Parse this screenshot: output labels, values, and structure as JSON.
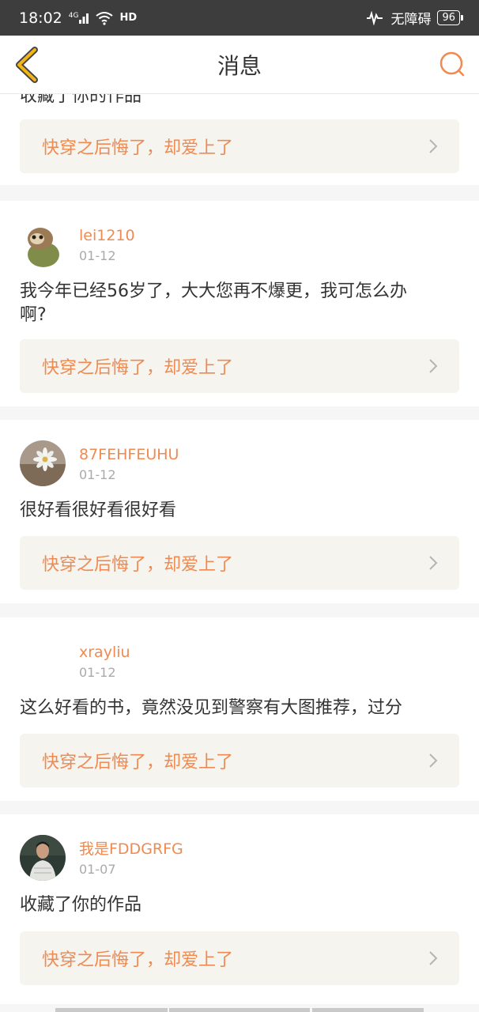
{
  "status": {
    "time": "18:02",
    "network": "4G",
    "hd": "HD",
    "accessibility": "无障碍",
    "battery": "96"
  },
  "header": {
    "title": "消息"
  },
  "colors": {
    "accent": "#ef8a52",
    "back_arrow": "#f2b515",
    "card_link_bg": "#f5f4ee"
  },
  "cards": [
    {
      "comment": "收藏了你的作品",
      "book": "快穿之后悔了，却爱上了"
    },
    {
      "username": "lei1210",
      "date": "01-12",
      "comment": "我今年已经56岁了，大大您再不爆更，我可怎么办啊?",
      "book": "快穿之后悔了，却爱上了"
    },
    {
      "username": "87FEHFEUHU",
      "date": "01-12",
      "comment": "很好看很好看很好看",
      "book": "快穿之后悔了，却爱上了"
    },
    {
      "username": "xrayliu",
      "date": "01-12",
      "comment": "这么好看的书，竟然没见到警察有大图推荐，过分",
      "book": "快穿之后悔了，却爱上了"
    },
    {
      "username": "我是FDDGRFG",
      "date": "01-07",
      "comment": "收藏了你的作品",
      "book": "快穿之后悔了，却爱上了"
    }
  ]
}
